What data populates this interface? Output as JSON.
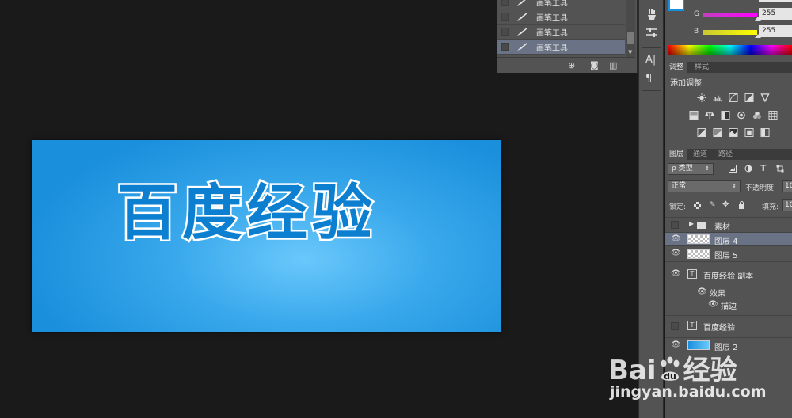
{
  "canvas": {
    "text": "百度经验",
    "bg_color": "#3aa9ec",
    "text_color": "#0c7fd0",
    "stroke_color": "#ffffff"
  },
  "history": {
    "items": [
      {
        "label": "画笔工具",
        "selected": false
      },
      {
        "label": "画笔工具",
        "selected": false
      },
      {
        "label": "画笔工具",
        "selected": false
      },
      {
        "label": "画笔工具",
        "selected": true
      }
    ],
    "footer_icons": [
      "new-snapshot-icon",
      "camera-icon",
      "trash-icon"
    ]
  },
  "tool_strip": {
    "icons": [
      "brush-presets-icon",
      "adjust-sliders-icon",
      "character-icon",
      "paragraph-icon"
    ],
    "character_glyph": "A|",
    "paragraph_glyph": "¶"
  },
  "color_panel": {
    "foreground": "#ffffff",
    "channels": [
      {
        "name": "G",
        "value": "255",
        "gradient": "#ff00ff"
      },
      {
        "name": "B",
        "value": "255",
        "gradient": "#ffff00"
      }
    ],
    "partial_top_value": "255"
  },
  "adjustments": {
    "tabs": [
      "调整",
      "样式"
    ],
    "title": "添加调整",
    "icon_rows": [
      [
        "brightness-icon",
        "levels-icon",
        "curves-icon",
        "exposure-icon",
        "vibrance-icon"
      ],
      [
        "hue-sat-icon",
        "color-balance-icon",
        "black-white-icon",
        "photo-filter-icon",
        "channel-mixer-icon",
        "color-lookup-icon"
      ],
      [
        "invert-icon",
        "posterize-icon",
        "threshold-icon",
        "selective-color-icon",
        "gradient-map-icon"
      ]
    ]
  },
  "layers": {
    "tabs": [
      "图层",
      "通道",
      "路径"
    ],
    "filter_label": "ρ 类型",
    "blend_mode": "正常",
    "opacity_label": "不透明度:",
    "opacity_value": "10",
    "lock_label": "锁定:",
    "fill_label": "填充:",
    "fill_value": "10",
    "items": [
      {
        "name": "素材",
        "kind": "group",
        "visible": false,
        "selected": false
      },
      {
        "name": "图层 4",
        "kind": "pixel",
        "visible": true,
        "selected": true
      },
      {
        "name": "图层 5",
        "kind": "pixel",
        "visible": true,
        "selected": false
      },
      {
        "name": "百度经验 副本",
        "kind": "text",
        "visible": true,
        "selected": false
      },
      {
        "name": "效果",
        "kind": "effects",
        "visible": true,
        "selected": false
      },
      {
        "name": "描边",
        "kind": "effect",
        "visible": true,
        "selected": false
      },
      {
        "name": "百度经验",
        "kind": "text",
        "visible": false,
        "selected": false
      },
      {
        "name": "图层 2",
        "kind": "gradient",
        "visible": true,
        "selected": false
      }
    ]
  },
  "watermark": {
    "logo_left": "Bai",
    "logo_right": "经验",
    "url": "jingyan.baidu.com"
  }
}
